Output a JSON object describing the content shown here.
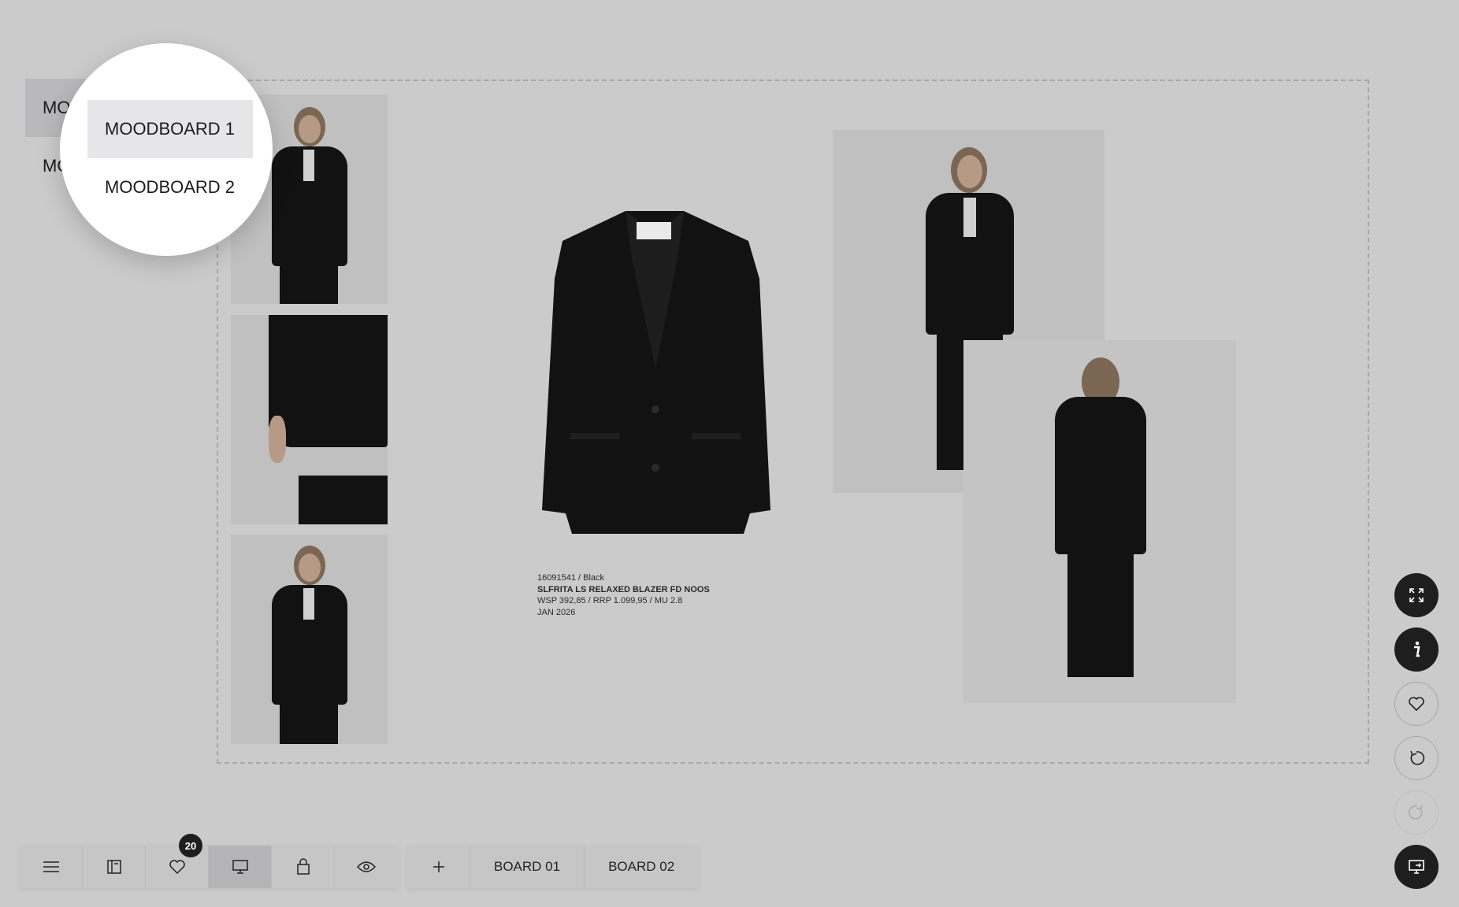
{
  "sidebar": {
    "items": [
      {
        "label": "MO"
      },
      {
        "label": "MO"
      }
    ]
  },
  "magnifier": {
    "items": [
      {
        "label": "MOODBOARD 1"
      },
      {
        "label": "MOODBOARD 2"
      }
    ]
  },
  "product": {
    "style_color": "16091541 / Black",
    "name": "SLFRITA LS RELAXED BLAZER FD NOOS",
    "pricing": "WSP 392,85 / RRP 1.099,95 / MU 2.8",
    "season": "JAN 2026"
  },
  "toolbar": {
    "favorites_count": "20",
    "tabs": [
      {
        "label": "BOARD 01"
      },
      {
        "label": "BOARD 02"
      }
    ]
  },
  "right_actions": [
    "expand-icon",
    "info-icon",
    "heart-icon",
    "undo-icon",
    "redo-icon",
    "present-icon"
  ],
  "colors": {
    "background": "#cbcbcb",
    "dark_button": "#1e1e1e",
    "active_item": "#e6e6e9"
  }
}
